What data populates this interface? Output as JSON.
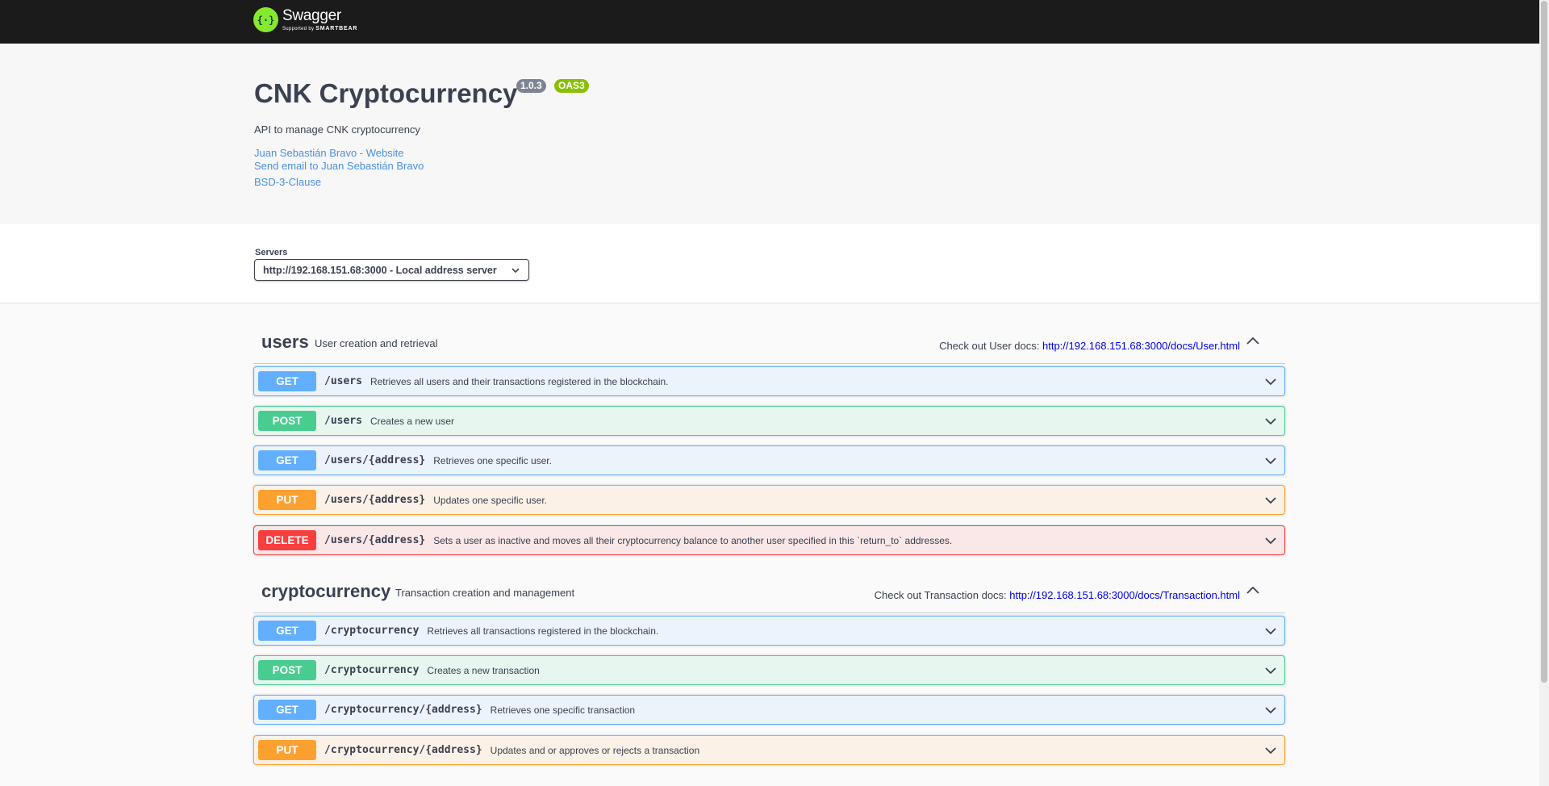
{
  "topbar": {
    "brand_name": "Swagger",
    "brand_sub_prefix": "Supported by",
    "brand_sub_company": "SMARTBEAR",
    "logo_color": "#85ea2d"
  },
  "info": {
    "title": "CNK Cryptocurrency",
    "version": "1.0.3",
    "oas": "OAS3",
    "description": "API to manage CNK cryptocurrency",
    "links": {
      "website": "Juan Sebastián Bravo - Website",
      "email": "Send email to Juan Sebastián Bravo",
      "license": "BSD-3-Clause"
    }
  },
  "servers": {
    "label": "Servers",
    "selected": "http://192.168.151.68:3000 - Local address server"
  },
  "tags": [
    {
      "name": "users",
      "description": "User creation and retrieval",
      "docs_prefix": "Check out User docs:",
      "docs_url": "http://192.168.151.68:3000/docs/User.html",
      "operations": [
        {
          "method": "GET",
          "path": "/users",
          "summary": "Retrieves all users and their transactions registered in the blockchain."
        },
        {
          "method": "POST",
          "path": "/users",
          "summary": "Creates a new user"
        },
        {
          "method": "GET",
          "path": "/users/{address}",
          "summary": "Retrieves one specific user."
        },
        {
          "method": "PUT",
          "path": "/users/{address}",
          "summary": "Updates one specific user."
        },
        {
          "method": "DELETE",
          "path": "/users/{address}",
          "summary": "Sets a user as inactive and moves all their cryptocurrency balance to another user specified in this `return_to` addresses."
        }
      ]
    },
    {
      "name": "cryptocurrency",
      "description": "Transaction creation and management",
      "docs_prefix": "Check out Transaction docs:",
      "docs_url": "http://192.168.151.68:3000/docs/Transaction.html",
      "operations": [
        {
          "method": "GET",
          "path": "/cryptocurrency",
          "summary": "Retrieves all transactions registered in the blockchain."
        },
        {
          "method": "POST",
          "path": "/cryptocurrency",
          "summary": "Creates a new transaction"
        },
        {
          "method": "GET",
          "path": "/cryptocurrency/{address}",
          "summary": "Retrieves one specific transaction"
        },
        {
          "method": "PUT",
          "path": "/cryptocurrency/{address}",
          "summary": "Updates and or approves or rejects a transaction"
        }
      ]
    }
  ],
  "colors": {
    "get": "#61affe",
    "post": "#49cc90",
    "put": "#fca130",
    "delete": "#f93e3e",
    "link": "#4990e2"
  }
}
